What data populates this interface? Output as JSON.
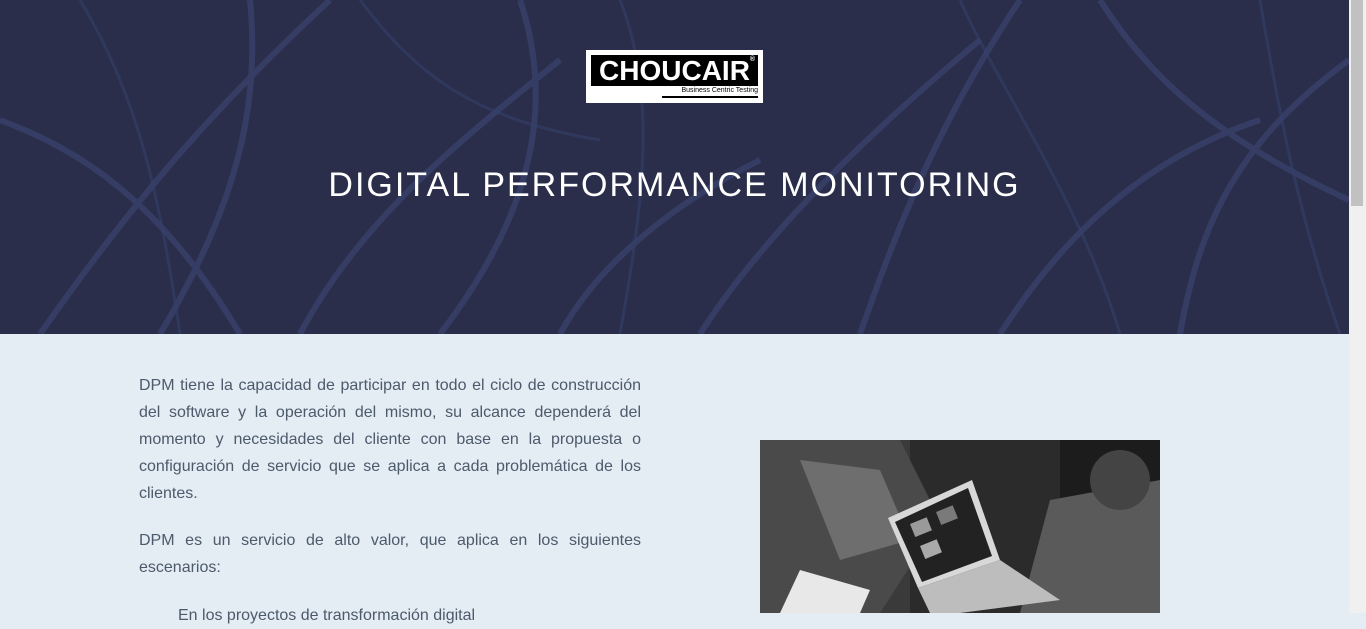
{
  "hero": {
    "logo_text": "CHOUCAIR",
    "logo_reg": "®",
    "logo_tagline": "Business Centric Testing",
    "title": "DIGITAL PERFORMANCE MONITORING"
  },
  "content": {
    "paragraph_1": "DPM tiene la capacidad de participar en todo el ciclo de construcción del software y la operación del mismo, su alcance dependerá del momento y necesidades del cliente con base en la propuesta o configuración de servicio que se aplica a cada problemática de los clientes.",
    "paragraph_2": "DPM es un servicio de alto valor, que aplica en los siguientes escenarios:",
    "list_items": [
      "En los proyectos de transformación digital"
    ]
  },
  "colors": {
    "hero_bg": "#2a2e4a",
    "content_bg": "#e4ecf4",
    "body_text": "#4c5a6b"
  }
}
